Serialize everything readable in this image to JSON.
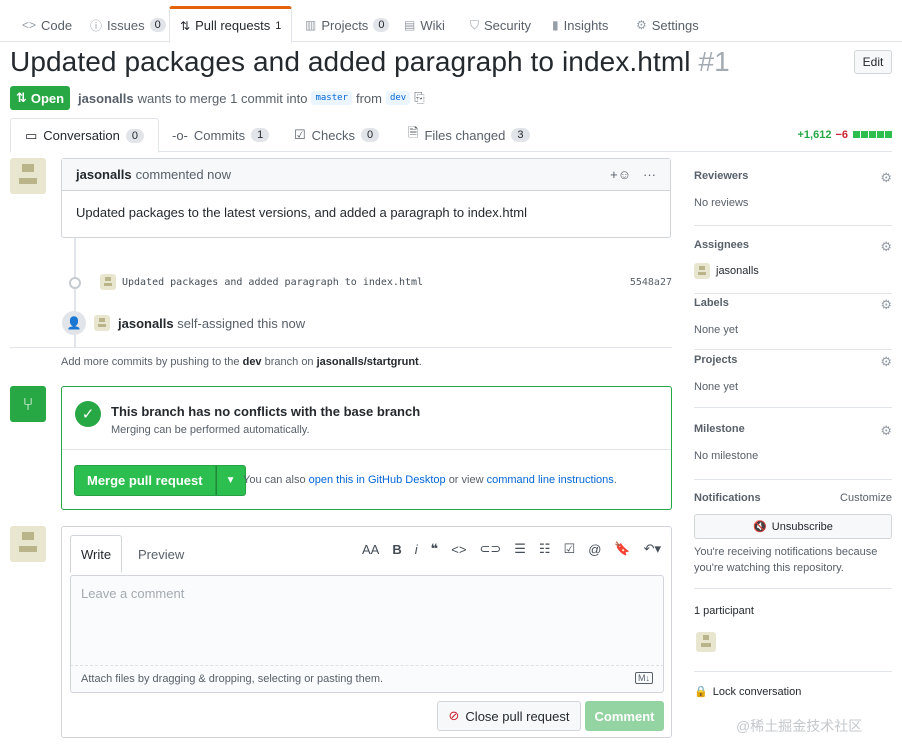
{
  "repo_nav": {
    "code": "Code",
    "issues": "Issues",
    "issues_count": "0",
    "pull_requests": "Pull requests",
    "pull_requests_count": "1",
    "projects": "Projects",
    "projects_count": "0",
    "wiki": "Wiki",
    "security": "Security",
    "insights": "Insights",
    "settings": "Settings"
  },
  "pr": {
    "title": "Updated packages and added paragraph to index.html",
    "number": "#1",
    "edit": "Edit",
    "state": "Open",
    "author": "jasonalls",
    "meta_text": "wants to merge 1 commit into",
    "base_branch": "master",
    "from": "from",
    "head_branch": "dev"
  },
  "tabs": {
    "conversation": "Conversation",
    "conversation_count": "0",
    "commits": "Commits",
    "commits_count": "1",
    "checks": "Checks",
    "checks_count": "0",
    "files_changed": "Files changed",
    "files_changed_count": "3",
    "additions": "+1,612",
    "deletions": "−6"
  },
  "comment": {
    "author": "jasonalls",
    "action": "commented now",
    "body": "Updated packages to the latest versions, and added a paragraph to index.html"
  },
  "timeline": {
    "commit_message": "Updated packages and added paragraph to index.html",
    "commit_sha": "5548a27",
    "assign_user": "jasonalls",
    "assign_text": "self-assigned this now"
  },
  "hint": {
    "prefix": "Add more commits by pushing to the",
    "branch": "dev",
    "middle": "branch on",
    "repo": "jasonalls/startgrunt",
    "suffix": "."
  },
  "merge": {
    "heading": "This branch has no conflicts with the base branch",
    "sub": "Merging can be performed automatically.",
    "button": "Merge pull request",
    "alt_prefix": "You can also",
    "alt_link1": "open this in GitHub Desktop",
    "alt_middle": "or view",
    "alt_link2": "command line instructions",
    "alt_suffix": "."
  },
  "new_comment": {
    "write_tab": "Write",
    "preview_tab": "Preview",
    "placeholder": "Leave a comment",
    "attach_text": "Attach files by dragging & dropping, selecting or pasting them.",
    "close_button": "Close pull request",
    "comment_button": "Comment"
  },
  "sidebar": {
    "reviewers": "Reviewers",
    "reviewers_value": "No reviews",
    "assignees": "Assignees",
    "assignees_value": "jasonalls",
    "labels": "Labels",
    "labels_value": "None yet",
    "projects": "Projects",
    "projects_value": "None yet",
    "milestone": "Milestone",
    "milestone_value": "No milestone",
    "notifications": "Notifications",
    "customize": "Customize",
    "unsubscribe": "Unsubscribe",
    "notif_text": "You're receiving notifications because you're watching this repository.",
    "participants": "1 participant",
    "lock": "Lock conversation"
  },
  "watermark": "@稀土掘金技术社区",
  "colors": {
    "green": "#28a745",
    "accent_orange": "#e36209",
    "link": "#0366d6"
  }
}
